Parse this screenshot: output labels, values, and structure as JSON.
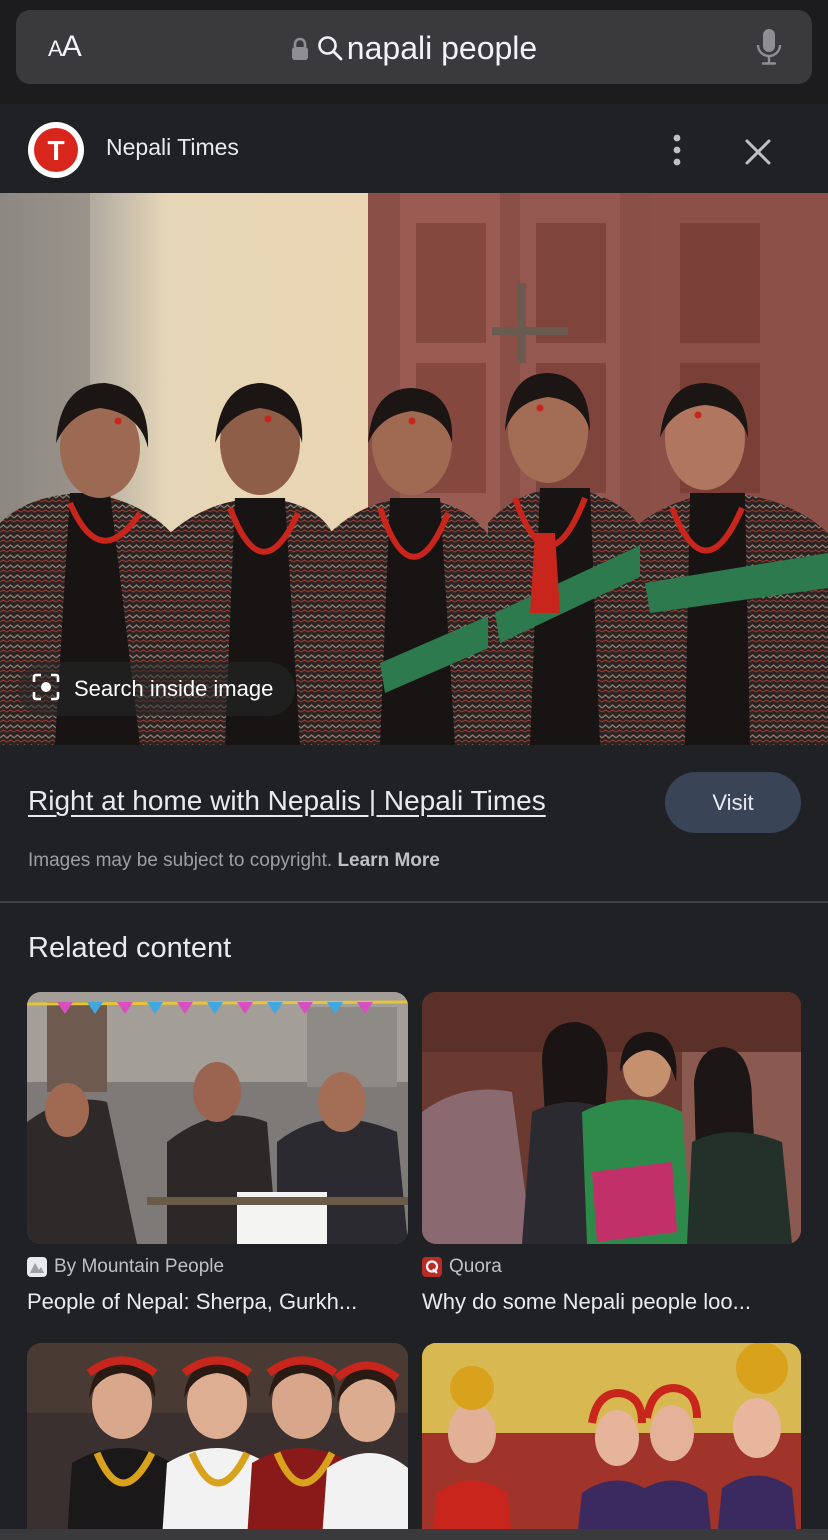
{
  "browser": {
    "text_size_label_small": "A",
    "text_size_label_large": "A",
    "query": "napali people",
    "icons": [
      "lock-icon",
      "search-icon",
      "microphone-icon"
    ]
  },
  "source": {
    "logo_letter": "T",
    "name": "Nepali Times",
    "accent": "#d9261c"
  },
  "main_image": {
    "search_inside_label": "Search inside image"
  },
  "result": {
    "title": "Right at home with Nepalis | Nepali Times",
    "visit_label": "Visit",
    "copyright_text": "Images may be subject to copyright.",
    "learn_more": "Learn More"
  },
  "related": {
    "title": "Related content",
    "items": [
      {
        "source": "By Mountain People",
        "caption": "People of Nepal: Sherpa, Gurkh..."
      },
      {
        "source": "Quora",
        "caption": "Why do some Nepali people loo..."
      },
      {
        "source": "",
        "caption": ""
      },
      {
        "source": "",
        "caption": ""
      }
    ]
  }
}
